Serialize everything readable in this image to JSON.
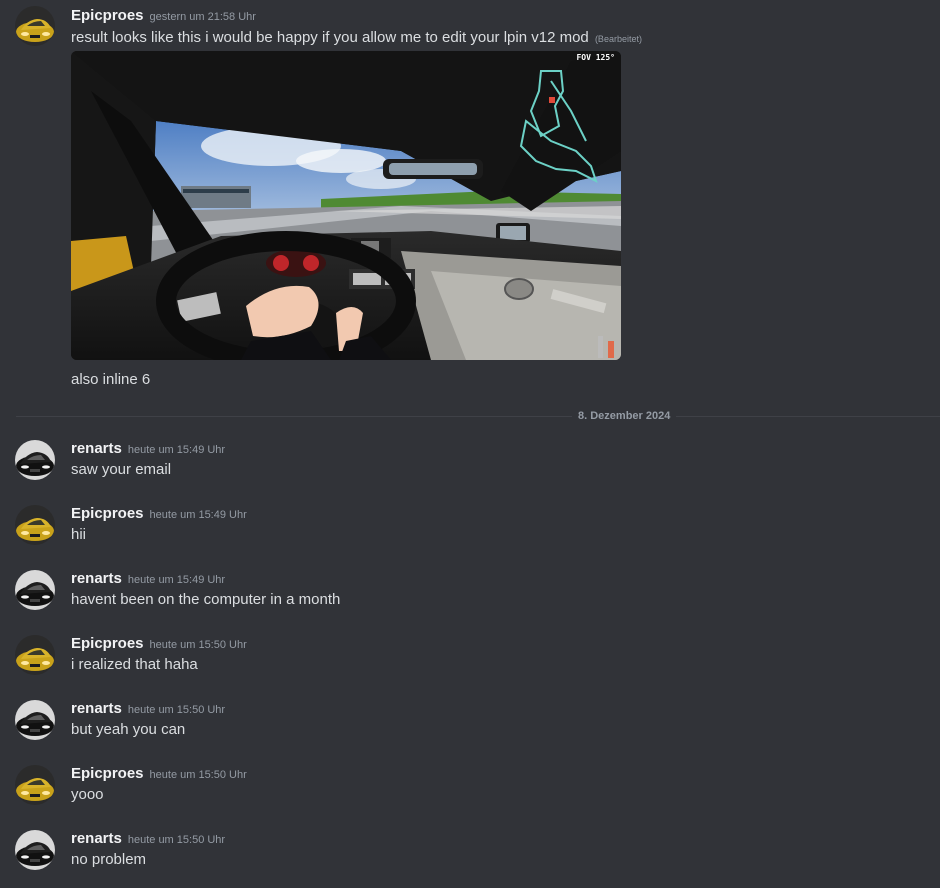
{
  "colors": {
    "background": "#313338",
    "author": "#f2f3f5",
    "text": "#dbdee1",
    "muted": "#949ba4",
    "divider": "#3f4147"
  },
  "first_message": {
    "author": "Epicproes",
    "timestamp": "gestern um 21:58 Uhr",
    "text": "result looks like this i would be happy if you allow me to edit your lpin v12 mod",
    "edited_label": "(Bearbeitet)",
    "attachment": {
      "kind": "image",
      "description": "in-game cockpit screenshot",
      "overlay_text": "FOV 125°"
    },
    "followup": "also inline 6"
  },
  "date_divider": "8. Dezember 2024",
  "messages": [
    {
      "author": "renarts",
      "timestamp": "heute um 15:49 Uhr",
      "text": "saw your email",
      "avatar": "black-car-avatar"
    },
    {
      "author": "Epicproes",
      "timestamp": "heute um 15:49 Uhr",
      "text": "hii",
      "avatar": "yellow-car-avatar"
    },
    {
      "author": "renarts",
      "timestamp": "heute um 15:49 Uhr",
      "text": "havent been on the computer in a month",
      "avatar": "black-car-avatar"
    },
    {
      "author": "Epicproes",
      "timestamp": "heute um 15:50 Uhr",
      "text": "i realized that haha",
      "avatar": "yellow-car-avatar"
    },
    {
      "author": "renarts",
      "timestamp": "heute um 15:50 Uhr",
      "text": "but yeah you can",
      "avatar": "black-car-avatar"
    },
    {
      "author": "Epicproes",
      "timestamp": "heute um 15:50 Uhr",
      "text": "yooo",
      "avatar": "yellow-car-avatar"
    },
    {
      "author": "renarts",
      "timestamp": "heute um 15:50 Uhr",
      "text": "no problem",
      "avatar": "black-car-avatar"
    }
  ]
}
